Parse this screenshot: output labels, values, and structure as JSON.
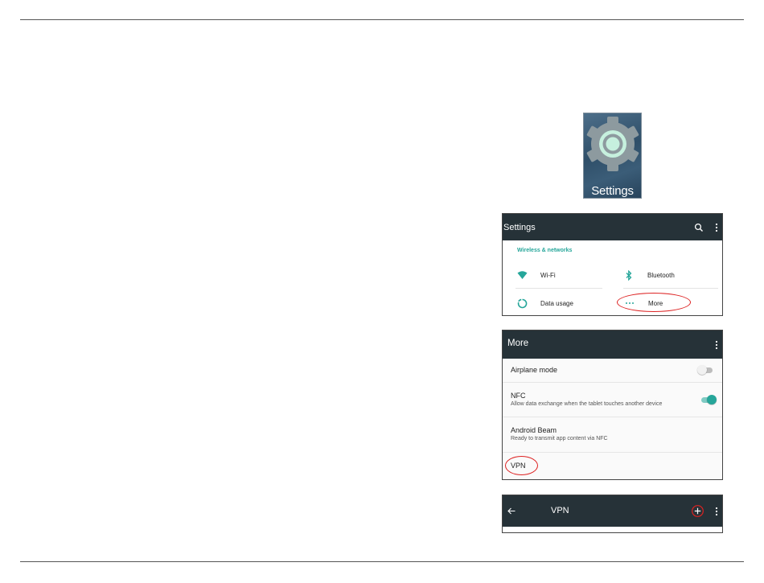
{
  "app_icon": {
    "label": "Settings",
    "icon": "settings-gear-icon"
  },
  "settings_screen": {
    "title": "Settings",
    "actions": [
      "search-icon",
      "overflow-menu-icon"
    ],
    "section": "Wireless & networks",
    "tiles": [
      {
        "label": "Wi-Fi",
        "icon": "wifi-icon"
      },
      {
        "label": "Bluetooth",
        "icon": "bluetooth-icon"
      },
      {
        "label": "Data usage",
        "icon": "data-usage-icon"
      },
      {
        "label": "More",
        "icon": "more-dots-icon",
        "highlighted": true
      }
    ]
  },
  "more_screen": {
    "title": "More",
    "items": [
      {
        "title": "Airplane mode",
        "summary": "",
        "switch_on": false
      },
      {
        "title": "NFC",
        "summary": "Allow data exchange when the tablet touches another device",
        "switch_on": true
      },
      {
        "title": "Android Beam",
        "summary": "Ready to transmit app content via NFC"
      },
      {
        "title": "VPN",
        "summary": "",
        "highlighted": true
      }
    ]
  },
  "vpn_screen": {
    "title": "VPN",
    "actions": [
      "back-arrow-icon",
      "add-icon",
      "overflow-menu-icon"
    ],
    "highlighted_action": "add-icon"
  },
  "colors": {
    "toolbar": "#263238",
    "accent": "#26a69a",
    "highlight": "#dd2222"
  }
}
